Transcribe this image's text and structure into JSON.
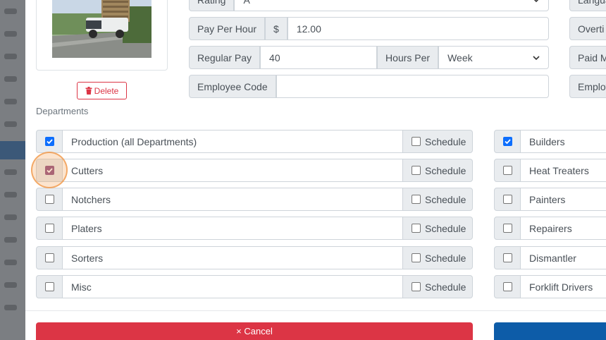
{
  "employee": {
    "rating_label": "Rating",
    "rating_value": "A",
    "pay_per_hour_label": "Pay Per Hour",
    "currency_symbol": "$",
    "pay_per_hour_value": "12.00",
    "regular_pay_label": "Regular Pay",
    "regular_pay_value": "40",
    "hours_per_label": "Hours Per",
    "hours_per_value": "Week",
    "employee_code_label": "Employee Code",
    "employee_code_value": ""
  },
  "right_column_labels": [
    "Langua",
    "Overti",
    "Paid M",
    "Employ"
  ],
  "photo": {
    "delete_label": "Delete"
  },
  "departments": {
    "section_label": "Departments",
    "schedule_label": "Schedule",
    "left": [
      {
        "name": "Production (all Departments)",
        "checked": true,
        "schedule": false
      },
      {
        "name": "Cutters",
        "checked": true,
        "schedule": false,
        "highlighted": true
      },
      {
        "name": "Notchers",
        "checked": false,
        "schedule": false
      },
      {
        "name": "Platers",
        "checked": false,
        "schedule": false
      },
      {
        "name": "Sorters",
        "checked": false,
        "schedule": false
      },
      {
        "name": "Misc",
        "checked": false,
        "schedule": false
      }
    ],
    "right": [
      {
        "name": "Builders",
        "checked": true
      },
      {
        "name": "Heat Treaters",
        "checked": false
      },
      {
        "name": "Painters",
        "checked": false
      },
      {
        "name": "Repairers",
        "checked": false
      },
      {
        "name": "Dismantler",
        "checked": false
      },
      {
        "name": "Forklift Drivers",
        "checked": false
      }
    ]
  },
  "footer": {
    "cancel_label": "× Cancel"
  }
}
